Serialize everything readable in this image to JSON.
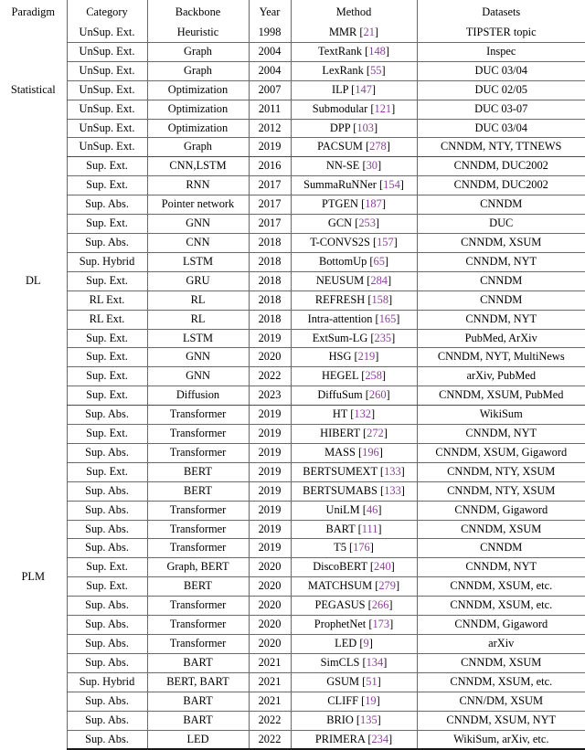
{
  "table": {
    "caption": "",
    "columns": [
      {
        "key": "paradigm",
        "label": "Paradigm"
      },
      {
        "key": "category",
        "label": "Category"
      },
      {
        "key": "backbone",
        "label": "Backbone"
      },
      {
        "key": "year",
        "label": "Year"
      },
      {
        "key": "method",
        "label": "Method"
      },
      {
        "key": "datasets",
        "label": "Datasets"
      }
    ],
    "citation_color": "#8d3f9e",
    "rule_color": "#1a1a1a",
    "groups": [
      {
        "paradigm": "Statistical",
        "rows": [
          {
            "category": "UnSup. Ext.",
            "backbone": "Heuristic",
            "year": "1998",
            "method": "MMR",
            "cite": "21",
            "datasets": "TIPSTER topic"
          },
          {
            "category": "UnSup. Ext.",
            "backbone": "Graph",
            "year": "2004",
            "method": "TextRank",
            "cite": "148",
            "datasets": "Inspec"
          },
          {
            "category": "UnSup. Ext.",
            "backbone": "Graph",
            "year": "2004",
            "method": "LexRank",
            "cite": "55",
            "datasets": "DUC 03/04"
          },
          {
            "category": "UnSup. Ext.",
            "backbone": "Optimization",
            "year": "2007",
            "method": "ILP",
            "cite": "147",
            "datasets": "DUC 02/05"
          },
          {
            "category": "UnSup. Ext.",
            "backbone": "Optimization",
            "year": "2011",
            "method": "Submodular",
            "cite": "121",
            "datasets": "DUC 03-07"
          },
          {
            "category": "UnSup. Ext.",
            "backbone": "Optimization",
            "year": "2012",
            "method": "DPP",
            "cite": "103",
            "datasets": "DUC 03/04"
          },
          {
            "category": "UnSup. Ext.",
            "backbone": "Graph",
            "year": "2019",
            "method": "PACSUM",
            "cite": "278",
            "datasets": "CNNDM, NTY, TTNEWS"
          }
        ]
      },
      {
        "paradigm": "DL",
        "rows": [
          {
            "category": "Sup. Ext.",
            "backbone": "CNN,LSTM",
            "year": "2016",
            "method": "NN-SE",
            "cite": "30",
            "datasets": "CNNDM, DUC2002"
          },
          {
            "category": "Sup. Ext.",
            "backbone": "RNN",
            "year": "2017",
            "method": "SummaRuNNer",
            "cite": "154",
            "datasets": "CNNDM, DUC2002"
          },
          {
            "category": "Sup. Abs.",
            "backbone": "Pointer network",
            "year": "2017",
            "method": "PTGEN",
            "cite": "187",
            "datasets": "CNNDM"
          },
          {
            "category": "Sup. Ext.",
            "backbone": "GNN",
            "year": "2017",
            "method": "GCN",
            "cite": "253",
            "datasets": "DUC"
          },
          {
            "category": "Sup. Abs.",
            "backbone": "CNN",
            "year": "2018",
            "method": "T-CONVS2S",
            "cite": "157",
            "datasets": "CNNDM, XSUM"
          },
          {
            "category": "Sup. Hybrid",
            "backbone": "LSTM",
            "year": "2018",
            "method": "BottomUp",
            "cite": "65",
            "datasets": "CNNDM, NYT"
          },
          {
            "category": "Sup. Ext.",
            "backbone": "GRU",
            "year": "2018",
            "method": "NEUSUM",
            "cite": "284",
            "datasets": "CNNDM"
          },
          {
            "category": "RL Ext.",
            "backbone": "RL",
            "year": "2018",
            "method": "REFRESH",
            "cite": "158",
            "datasets": "CNNDM"
          },
          {
            "category": "RL Ext.",
            "backbone": "RL",
            "year": "2018",
            "method": "Intra-attention",
            "cite": "165",
            "datasets": "CNNDM, NYT"
          },
          {
            "category": "Sup. Ext.",
            "backbone": "LSTM",
            "year": "2019",
            "method": "ExtSum-LG",
            "cite": "235",
            "datasets": "PubMed, ArXiv"
          },
          {
            "category": "Sup. Ext.",
            "backbone": "GNN",
            "year": "2020",
            "method": "HSG",
            "cite": "219",
            "datasets": "CNNDM, NYT, MultiNews"
          },
          {
            "category": "Sup. Ext.",
            "backbone": "GNN",
            "year": "2022",
            "method": "HEGEL",
            "cite": "258",
            "datasets": "arXiv, PubMed"
          },
          {
            "category": "Sup. Ext.",
            "backbone": "Diffusion",
            "year": "2023",
            "method": "DiffuSum",
            "cite": "260",
            "datasets": "CNNDM, XSUM, PubMed"
          }
        ]
      },
      {
        "paradigm": "PLM",
        "rows": [
          {
            "category": "Sup. Abs.",
            "backbone": "Transformer",
            "year": "2019",
            "method": "HT",
            "cite": "132",
            "datasets": "WikiSum"
          },
          {
            "category": "Sup. Ext.",
            "backbone": "Transformer",
            "year": "2019",
            "method": "HIBERT",
            "cite": "272",
            "datasets": "CNNDM, NYT"
          },
          {
            "category": "Sup. Abs.",
            "backbone": "Transformer",
            "year": "2019",
            "method": "MASS",
            "cite": "196",
            "datasets": "CNNDM, XSUM, Gigaword"
          },
          {
            "category": "Sup. Ext.",
            "backbone": "BERT",
            "year": "2019",
            "method": "BERTSUMEXT",
            "cite": "133",
            "datasets": "CNNDM, NTY, XSUM"
          },
          {
            "category": "Sup. Abs.",
            "backbone": "BERT",
            "year": "2019",
            "method": "BERTSUMABS",
            "cite": "133",
            "datasets": "CNNDM, NTY, XSUM"
          },
          {
            "category": "Sup. Abs.",
            "backbone": "Transformer",
            "year": "2019",
            "method": "UniLM",
            "cite": "46",
            "datasets": "CNNDM, Gigaword"
          },
          {
            "category": "Sup. Abs.",
            "backbone": "Transformer",
            "year": "2019",
            "method": "BART",
            "cite": "111",
            "datasets": "CNNDM, XSUM"
          },
          {
            "category": "Sup. Abs.",
            "backbone": "Transformer",
            "year": "2019",
            "method": "T5",
            "cite": "176",
            "datasets": "CNNDM"
          },
          {
            "category": "Sup. Ext.",
            "backbone": "Graph, BERT",
            "year": "2020",
            "method": "DiscoBERT",
            "cite": "240",
            "datasets": "CNNDM, NYT"
          },
          {
            "category": "Sup. Ext.",
            "backbone": "BERT",
            "year": "2020",
            "method": "MATCHSUM",
            "cite": "279",
            "datasets": "CNNDM, XSUM, etc."
          },
          {
            "category": "Sup. Abs.",
            "backbone": "Transformer",
            "year": "2020",
            "method": "PEGASUS",
            "cite": "266",
            "datasets": "CNNDM, XSUM, etc."
          },
          {
            "category": "Sup. Abs.",
            "backbone": "Transformer",
            "year": "2020",
            "method": "ProphetNet",
            "cite": "173",
            "datasets": "CNNDM, Gigaword"
          },
          {
            "category": "Sup. Abs.",
            "backbone": "Transformer",
            "year": "2020",
            "method": "LED",
            "cite": "9",
            "datasets": "arXiv"
          },
          {
            "category": "Sup. Abs.",
            "backbone": "BART",
            "year": "2021",
            "method": "SimCLS",
            "cite": "134",
            "datasets": "CNNDM, XSUM"
          },
          {
            "category": "Sup. Hybrid",
            "backbone": "BERT, BART",
            "year": "2021",
            "method": "GSUM",
            "cite": "51",
            "datasets": "CNNDM, XSUM, etc."
          },
          {
            "category": "Sup. Abs.",
            "backbone": "BART",
            "year": "2021",
            "method": "CLIFF",
            "cite": "19",
            "datasets": "CNN/DM, XSUM"
          },
          {
            "category": "Sup. Abs.",
            "backbone": "BART",
            "year": "2022",
            "method": "BRIO",
            "cite": "135",
            "datasets": "CNNDM, XSUM, NYT"
          },
          {
            "category": "Sup. Abs.",
            "backbone": "LED",
            "year": "2022",
            "method": "PRIMERA",
            "cite": "234",
            "datasets": "WikiSum, arXiv, etc."
          }
        ]
      }
    ]
  }
}
